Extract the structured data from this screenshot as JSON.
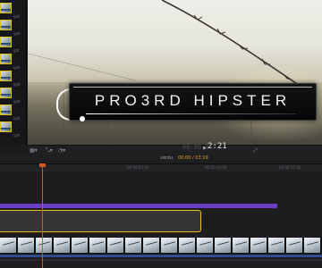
{
  "browser": {
    "labels": [
      "ight",
      "ight",
      "ght",
      "ight",
      "ight",
      "ight",
      "ight",
      "ight",
      "ight"
    ]
  },
  "viewer": {
    "title_text": "PRO3RD HIPSTER",
    "timecode_dim": "00:00:0",
    "timecode": "2:21"
  },
  "timeline": {
    "project_name": "ventu",
    "project_duration": "00:00 / 03:19",
    "ruler_ticks": [
      "00:00:05:00",
      "00:00:10:00",
      "00:00:15:00"
    ]
  },
  "colors": {
    "accent_selection": "#e9bf12",
    "title_track": "#6a3ec6",
    "playhead": "#d8522a",
    "audio": "#2f4c8c"
  }
}
